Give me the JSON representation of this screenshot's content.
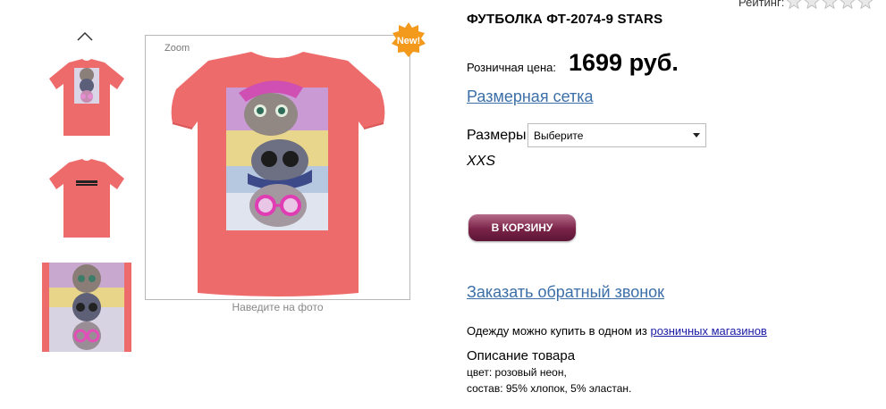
{
  "product": {
    "title": "ФУТБОЛКА ФТ-2074-9 STARS",
    "price_label": "Розничная цена:",
    "price": "1699 руб.",
    "size_chart_link": "Размерная сетка",
    "sizes_label": "Размеры",
    "size_select_value": "Выберите",
    "size_value": "XXS",
    "add_to_cart": "В КОРЗИНУ",
    "callback_link": "Заказать обратный звонок",
    "buy_text": "Одежду можно купить в одном из",
    "buy_link": "розничных магазинов",
    "description_title": "Описание товара",
    "description_color": "цвет: розовый неон,",
    "description_composition": "состав: 95% хлопок, 5% эластан."
  },
  "rating": {
    "label": "Рейтинг:",
    "stars": 0,
    "max_stars": 5
  },
  "gallery": {
    "zoom_label": "Zoom",
    "hover_hint": "Наведите на фото",
    "new_badge": "New!",
    "icons": {
      "scroll_up": "chevron-up-icon"
    }
  },
  "colors": {
    "shirt": "#ee6b6b",
    "accent_link": "#3c6fa8",
    "cart_button": "#7a2348",
    "badge": "#f39a1c"
  }
}
